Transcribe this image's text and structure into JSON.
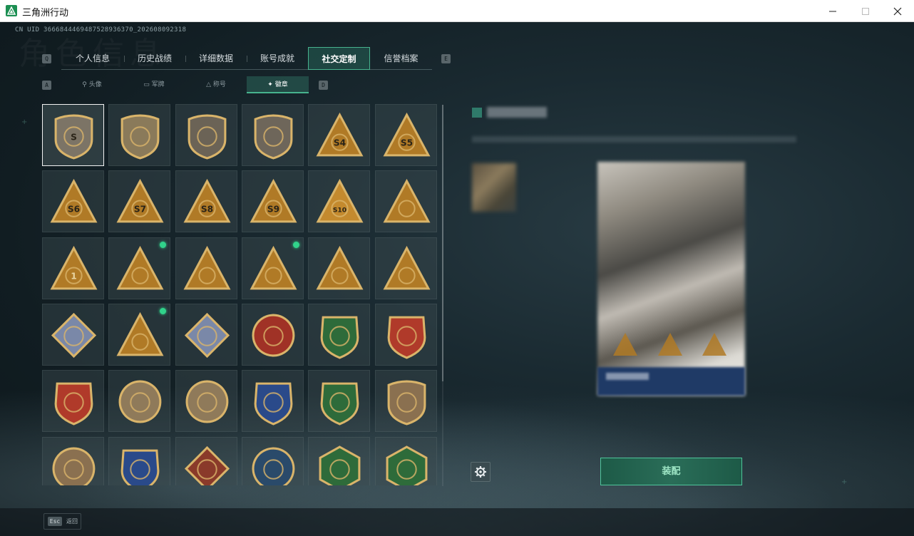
{
  "window": {
    "title": "三角洲行动",
    "minimize_icon": "minimize-icon",
    "maximize_icon": "maximize-icon",
    "close_icon": "close-icon"
  },
  "uid": "CN UID 3666844469487528936370_202608092318",
  "watermark": "角色信息",
  "tabs": {
    "left_key": "Q",
    "right_key": "E",
    "items": [
      {
        "label": "个人信息",
        "active": false
      },
      {
        "label": "历史战绩",
        "active": false
      },
      {
        "label": "详细数据",
        "active": false
      },
      {
        "label": "账号成就",
        "active": false
      },
      {
        "label": "社交定制",
        "active": true
      },
      {
        "label": "信誉档案",
        "active": false
      }
    ]
  },
  "subtabs": {
    "left_key": "A",
    "right_key": "D",
    "items": [
      {
        "label": "头像",
        "icon": "person-icon",
        "active": false
      },
      {
        "label": "军牌",
        "icon": "dogtag-icon",
        "active": false
      },
      {
        "label": "称号",
        "icon": "title-icon",
        "active": false
      },
      {
        "label": "徽章",
        "icon": "badge-icon",
        "active": true
      }
    ]
  },
  "badges": [
    {
      "name": "delta-logo-badge",
      "shape": "shield",
      "color": "#7c7466",
      "mark": "S",
      "selected": true,
      "new": false
    },
    {
      "name": "helicopter-badge",
      "shape": "shield",
      "color": "#8a7a5a",
      "mark": "",
      "selected": false,
      "new": false
    },
    {
      "name": "diamond-emblem-badge",
      "shape": "shield",
      "color": "#6b6356",
      "mark": "",
      "selected": false,
      "new": false
    },
    {
      "name": "dagger-badge",
      "shape": "shield",
      "color": "#6e665a",
      "mark": "",
      "selected": false,
      "new": false
    },
    {
      "name": "season-s4-badge",
      "shape": "triangle",
      "color": "#b07a26",
      "mark": "S4",
      "selected": false,
      "new": false
    },
    {
      "name": "season-s5-badge",
      "shape": "triangle",
      "color": "#b07a26",
      "mark": "S5",
      "selected": false,
      "new": false
    },
    {
      "name": "season-s6-badge",
      "shape": "triangle",
      "color": "#b07a26",
      "mark": "S6",
      "selected": false,
      "new": false
    },
    {
      "name": "season-s7-badge",
      "shape": "triangle",
      "color": "#b07a26",
      "mark": "S7",
      "selected": false,
      "new": false
    },
    {
      "name": "season-s8-badge",
      "shape": "triangle",
      "color": "#b07a26",
      "mark": "S8",
      "selected": false,
      "new": false
    },
    {
      "name": "season-s9-badge",
      "shape": "triangle",
      "color": "#b07a26",
      "mark": "S9",
      "selected": false,
      "new": false
    },
    {
      "name": "season-s10-badge",
      "shape": "triangle",
      "color": "#c48a2e",
      "mark": "S10",
      "selected": false,
      "new": false
    },
    {
      "name": "boat-badge",
      "shape": "triangle",
      "color": "#b07a26",
      "mark": "",
      "selected": false,
      "new": false
    },
    {
      "name": "number-one-badge",
      "shape": "triangle",
      "color": "#b07a26",
      "mark": "1",
      "selected": false,
      "new": false
    },
    {
      "name": "crate-badge",
      "shape": "triangle",
      "color": "#b07a26",
      "mark": "",
      "selected": false,
      "new": true
    },
    {
      "name": "seated-figure-badge",
      "shape": "triangle",
      "color": "#b07a26",
      "mark": "",
      "selected": false,
      "new": false
    },
    {
      "name": "gem-badge",
      "shape": "triangle",
      "color": "#b07a26",
      "mark": "",
      "selected": false,
      "new": true
    },
    {
      "name": "soldiers-badge",
      "shape": "triangle",
      "color": "#b07a26",
      "mark": "",
      "selected": false,
      "new": false
    },
    {
      "name": "rocket-badge",
      "shape": "triangle",
      "color": "#b07a26",
      "mark": "",
      "selected": false,
      "new": false
    },
    {
      "name": "camera-diamond-badge",
      "shape": "diamond",
      "color": "#7a88a8",
      "mark": "",
      "selected": false,
      "new": false
    },
    {
      "name": "gasmask-soldier-badge",
      "shape": "triangle",
      "color": "#b07a26",
      "mark": "",
      "selected": false,
      "new": true
    },
    {
      "name": "launcher-diamond-badge",
      "shape": "diamond",
      "color": "#7a88a8",
      "mark": "",
      "selected": false,
      "new": false
    },
    {
      "name": "star-medal-badge",
      "shape": "round",
      "color": "#a03226",
      "mark": "",
      "selected": false,
      "new": false
    },
    {
      "name": "green-crest-badge",
      "shape": "crest",
      "color": "#2e6b3a",
      "mark": "",
      "selected": false,
      "new": false
    },
    {
      "name": "red-crest-badge",
      "shape": "crest",
      "color": "#b03a2a",
      "mark": "",
      "selected": false,
      "new": false
    },
    {
      "name": "red-shield-crest-badge",
      "shape": "crest",
      "color": "#b03a2a",
      "mark": "",
      "selected": false,
      "new": false
    },
    {
      "name": "skull-crosshair-badge",
      "shape": "round",
      "color": "#8f7a5a",
      "mark": "",
      "selected": false,
      "new": false
    },
    {
      "name": "gasmask-crosshair-badge",
      "shape": "round",
      "color": "#8f7a5a",
      "mark": "",
      "selected": false,
      "new": false
    },
    {
      "name": "blue-rifle-shield-badge",
      "shape": "crest",
      "color": "#2a4a8a",
      "mark": "",
      "selected": false,
      "new": false
    },
    {
      "name": "green-rifle-shield-badge",
      "shape": "crest",
      "color": "#2e6b3a",
      "mark": "",
      "selected": false,
      "new": false
    },
    {
      "name": "gold-rifle-shield-badge",
      "shape": "shield",
      "color": "#8a7050",
      "mark": "",
      "selected": false,
      "new": false
    },
    {
      "name": "sniper-round-badge",
      "shape": "round",
      "color": "#8a7050",
      "mark": "",
      "selected": false,
      "new": false
    },
    {
      "name": "blue-gold-crosshair-badge",
      "shape": "crest",
      "color": "#2a4a8a",
      "mark": "",
      "selected": false,
      "new": false
    },
    {
      "name": "wolf-badge",
      "shape": "diamond",
      "color": "#8a3a2a",
      "mark": "",
      "selected": false,
      "new": false
    },
    {
      "name": "eagle-badge",
      "shape": "round",
      "color": "#2a4a6a",
      "mark": "",
      "selected": false,
      "new": false
    },
    {
      "name": "wasp-green-badge",
      "shape": "hex",
      "color": "#2e6b3a",
      "mark": "",
      "selected": false,
      "new": false
    },
    {
      "name": "wasp-gold-badge",
      "shape": "hex",
      "color": "#2e6b3a",
      "mark": "",
      "selected": false,
      "new": false
    }
  ],
  "detail": {
    "equip_label": "装配",
    "settings_icon": "gear-icon"
  },
  "footer": {
    "esc_key": "Esc",
    "esc_label": "返回"
  },
  "colors": {
    "accent": "#47b38e",
    "badge_gold": "#d9b46a",
    "new_dot": "#31d38b"
  }
}
